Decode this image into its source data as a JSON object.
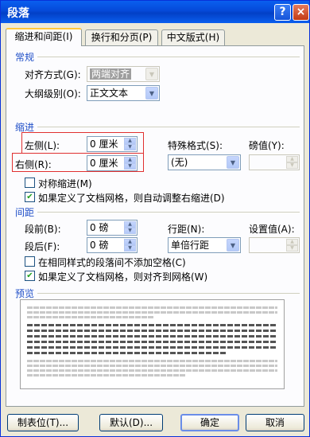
{
  "window": {
    "title": "段落",
    "help_glyph": "?",
    "close_glyph": "×"
  },
  "tabs": [
    {
      "label": "缩进和间距(I)"
    },
    {
      "label": "换行和分页(P)"
    },
    {
      "label": "中文版式(H)"
    }
  ],
  "general": {
    "section_title": "常规",
    "alignment_label": "对齐方式(G):",
    "alignment_value": "两端对齐",
    "outline_label": "大纲级别(O):",
    "outline_value": "正文文本"
  },
  "indent": {
    "section_title": "缩进",
    "left_label": "左侧(L):",
    "left_value": "0 厘米",
    "right_label": "右侧(R):",
    "right_value": "0 厘米",
    "special_label": "特殊格式(S):",
    "special_value": "(无)",
    "by_label": "磅值(Y):",
    "by_value": "",
    "mirror_label": "对称缩进(M)",
    "mirror_checked": false,
    "grid_label": "如果定义了文档网格，则自动调整右缩进(D)",
    "grid_checked": true
  },
  "spacing": {
    "section_title": "间距",
    "before_label": "段前(B):",
    "before_value": "0 磅",
    "after_label": "段后(F):",
    "after_value": "0 磅",
    "line_label": "行距(N):",
    "line_value": "单倍行距",
    "at_label": "设置值(A):",
    "at_value": "",
    "no_space_label": "在相同样式的段落间不添加空格(C)",
    "no_space_checked": false,
    "snap_label": "如果定义了文档网格，则对齐到网格(W)",
    "snap_checked": true
  },
  "preview": {
    "section_title": "预览"
  },
  "buttons": {
    "tabs_label": "制表位(T)...",
    "default_label": "默认(D)...",
    "ok_label": "确定",
    "cancel_label": "取消"
  },
  "colors": {
    "title_bar": "#0a5fef",
    "section_text": "#2150c8",
    "highlight_box": "#e03030",
    "dialog_bg": "#ece9d8"
  },
  "icons": [
    "dropdown-arrow-icon",
    "spin-up-icon",
    "spin-down-icon",
    "check-icon",
    "help-icon",
    "close-icon"
  ]
}
